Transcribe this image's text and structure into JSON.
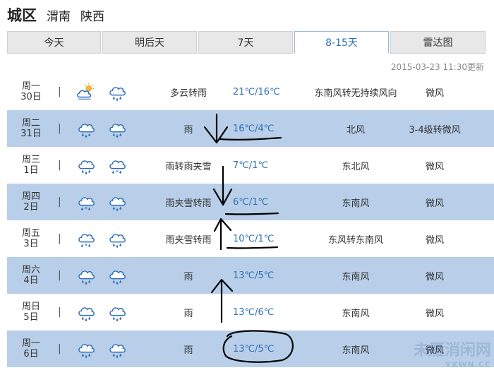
{
  "header": {
    "city": "城区",
    "region1": "渭南",
    "region2": "陕西"
  },
  "tabs": [
    {
      "label": "今天",
      "active": false
    },
    {
      "label": "明后天",
      "active": false
    },
    {
      "label": "7天",
      "active": false
    },
    {
      "label": "8-15天",
      "active": true
    },
    {
      "label": "雷达图",
      "active": false
    }
  ],
  "update_time": "2015-03-23 11:30更新",
  "days": [
    {
      "weekday": "周一",
      "date": "30日",
      "icon1": "partly-cloudy-icon",
      "icon2": "rain-icon",
      "desc": "多云转雨",
      "temp": "21℃/16℃",
      "wind": "东南风转无持续风向",
      "force": "微风"
    },
    {
      "weekday": "周二",
      "date": "31日",
      "icon1": "rain-icon",
      "icon2": "rain-icon",
      "desc": "雨",
      "temp": "16℃/4℃",
      "wind": "北风",
      "force": "3-4级转微风"
    },
    {
      "weekday": "周三",
      "date": "1日",
      "icon1": "rain-icon",
      "icon2": "sleet-icon",
      "desc": "雨转雨夹雪",
      "temp": "7℃/1℃",
      "wind": "东北风",
      "force": "微风"
    },
    {
      "weekday": "周四",
      "date": "2日",
      "icon1": "sleet-icon",
      "icon2": "rain-icon",
      "desc": "雨夹雪转雨",
      "temp": "6℃/1℃",
      "wind": "东南风",
      "force": "微风"
    },
    {
      "weekday": "周五",
      "date": "3日",
      "icon1": "sleet-icon",
      "icon2": "rain-icon",
      "desc": "雨夹雪转雨",
      "temp": "10℃/1℃",
      "wind": "东风转东南风",
      "force": "微风"
    },
    {
      "weekday": "周六",
      "date": "4日",
      "icon1": "rain-icon",
      "icon2": "rain-icon",
      "desc": "雨",
      "temp": "13℃/5℃",
      "wind": "东南风",
      "force": "微风"
    },
    {
      "weekday": "周日",
      "date": "5日",
      "icon1": "rain-icon",
      "icon2": "rain-icon",
      "desc": "雨",
      "temp": "13℃/6℃",
      "wind": "东南风",
      "force": "微风"
    },
    {
      "weekday": "周一",
      "date": "6日",
      "icon1": "rain-icon",
      "icon2": "rain-icon",
      "desc": "雨",
      "temp": "13℃/5℃",
      "wind": "东南风",
      "force": "微风"
    }
  ],
  "colors": {
    "accent": "#2f6fb8",
    "row_alt": "#b9cfe9",
    "tab_bg": "#e8e8e8",
    "ink": "#000000"
  },
  "watermark": {
    "line1": "未雁消闲网",
    "line2": "YXWN.CC"
  }
}
